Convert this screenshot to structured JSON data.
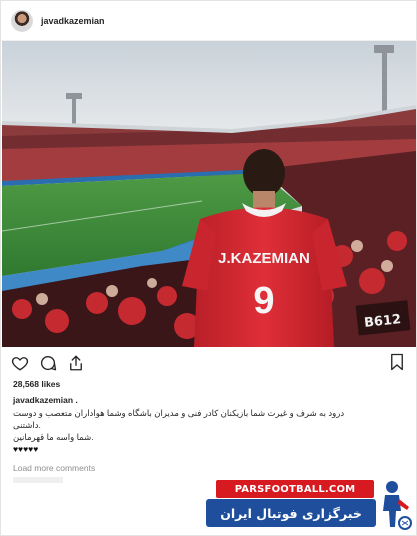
{
  "post": {
    "username": "javadkazemian",
    "likes": "28,568 likes",
    "caption_user": "javadkazemian .",
    "caption_lines": [
      "درود به شرف و غیرت شما بازیکنان کادر فنی و مدیران باشگاه وشما هواداران متعصب و دوست",
      ".داشتنی",
      ".شما واسه ما قهرمانین",
      "♥♥♥♥♥"
    ],
    "load_more": "Load more comments"
  },
  "photo": {
    "jersey_name": "J.KAZEMIAN",
    "jersey_number": "9",
    "banner_text": "B612"
  },
  "watermark": {
    "top": "PARSFOOTBALL.COM",
    "bottom": "خبرگزاری فوتبال ایران"
  },
  "colors": {
    "jersey": "#d32630",
    "watermark_red": "#d71920",
    "watermark_blue": "#1f4f9c",
    "pitch": "#3d8b3a"
  },
  "icons": [
    "avatar",
    "heart-icon",
    "comment-icon",
    "share-icon",
    "bookmark-icon",
    "football-player-logo"
  ]
}
